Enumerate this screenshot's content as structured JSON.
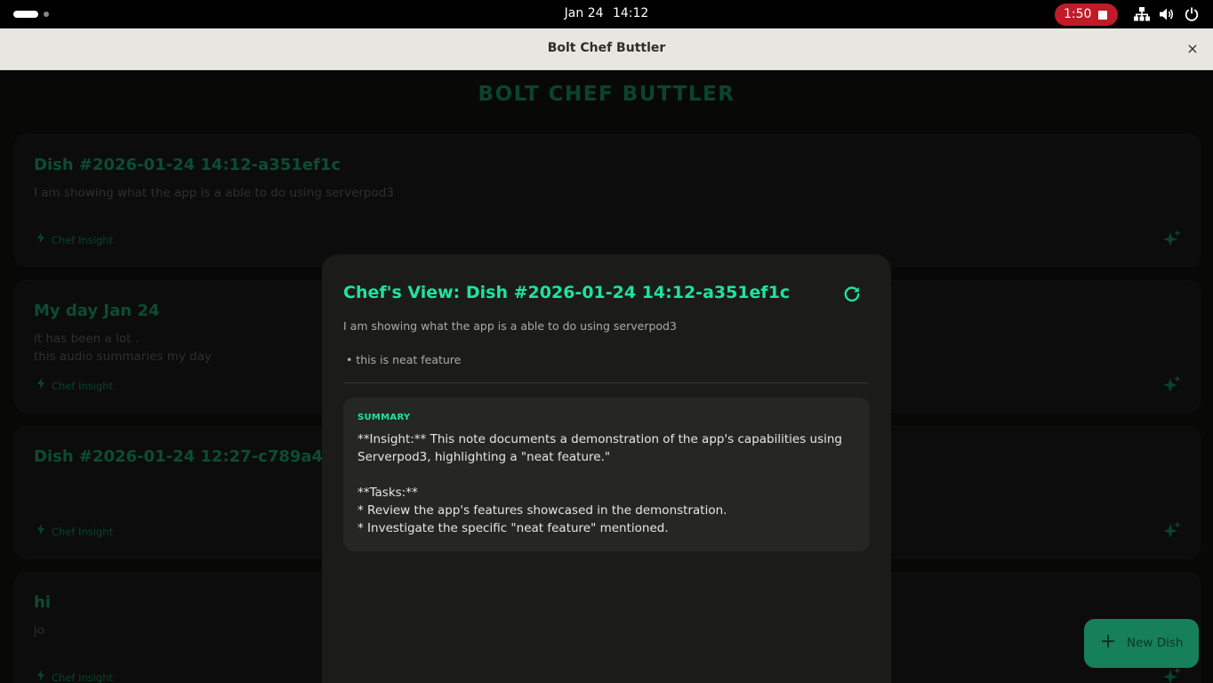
{
  "system_bar": {
    "date": "Jan 24",
    "time": "14:12",
    "recording_time": "1:50"
  },
  "window": {
    "title": "Bolt Chef Buttler",
    "close_glyph": "×"
  },
  "app": {
    "title": "BOLT CHEF BUTTLER",
    "insight_label": "Chef Insight",
    "fab_label": "New Dish"
  },
  "cards": [
    {
      "title": "Dish #2026-01-24 14:12-a351ef1c",
      "body": "I am showing what the app is a able to do using serverpod3"
    },
    {
      "title": "My day Jan 24",
      "body": "it has been a lot .\nthis audio summaries my day"
    },
    {
      "title": "Dish #2026-01-24 12:27-c789a43e",
      "body": ""
    },
    {
      "title": "hi",
      "body": "jo"
    }
  ],
  "modal": {
    "title": "Chef's View: Dish #2026-01-24 14:12-a351ef1c",
    "description": "I am showing what the app is a able to do using serverpod3",
    "bullet": "• this is neat feature",
    "summary_label": "SUMMARY",
    "summary_text": "**Insight:** This note documents a demonstration of the app's capabilities using Serverpod3, highlighting a \"neat feature.\"\n\n**Tasks:**\n* Review the app's features showcased in the demonstration.\n* Investigate the specific \"neat feature\" mentioned."
  },
  "icons": {
    "activities": "activities-indicator",
    "recording_stop": "stop-icon",
    "network": "network-icon",
    "volume": "volume-icon",
    "power": "power-icon",
    "close": "close-icon",
    "insight": "bolt-icon",
    "sparkle": "sparkle-icon",
    "refresh": "refresh-icon",
    "add": "plus-icon"
  },
  "colors": {
    "accent": "#168a5d",
    "accent_bright": "#1ee3a0",
    "recording": "#c01c28",
    "fab": "#15805a"
  }
}
